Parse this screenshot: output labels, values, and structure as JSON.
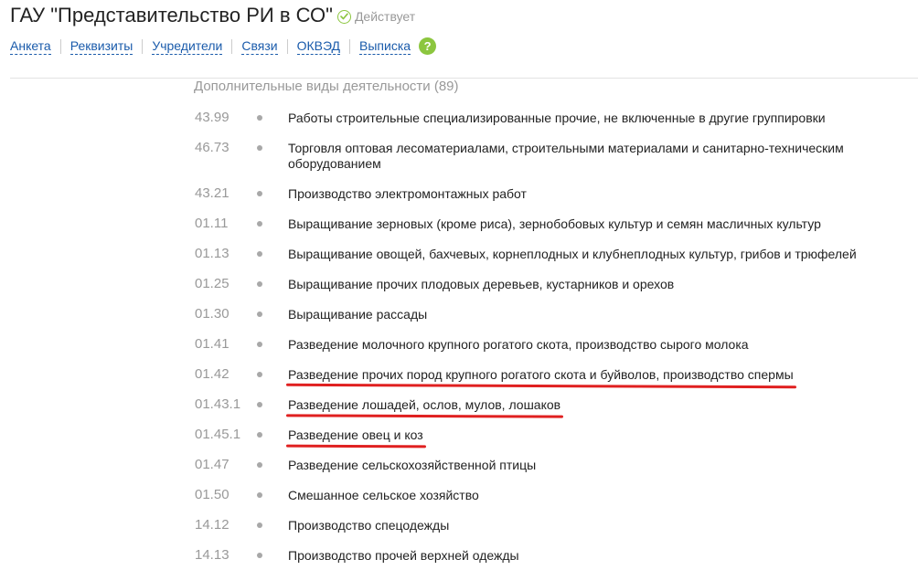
{
  "header": {
    "title": "ГАУ \"Представительство РИ в СО\"",
    "status": "Действует"
  },
  "nav": {
    "items": [
      "Анкета",
      "Реквизиты",
      "Учредители",
      "Связи",
      "ОКВЭД",
      "Выписка"
    ],
    "help_label": "?"
  },
  "section": {
    "title": "Дополнительные виды деятельности (89)"
  },
  "activities": [
    {
      "code": "43.99",
      "name": "Работы строительные специализированные прочие, не включенные в другие группировки",
      "highlighted": false
    },
    {
      "code": "46.73",
      "name": "Торговля оптовая лесоматериалами, строительными материалами и санитарно-техническим оборудованием",
      "highlighted": false
    },
    {
      "code": "43.21",
      "name": "Производство электромонтажных работ",
      "highlighted": false
    },
    {
      "code": "01.11",
      "name": "Выращивание зерновых (кроме риса), зернобобовых культур и семян масличных культур",
      "highlighted": false
    },
    {
      "code": "01.13",
      "name": "Выращивание овощей, бахчевых, корнеплодных и клубнеплодных культур, грибов и трюфелей",
      "highlighted": false
    },
    {
      "code": "01.25",
      "name": "Выращивание прочих плодовых деревьев, кустарников и орехов",
      "highlighted": false
    },
    {
      "code": "01.30",
      "name": "Выращивание рассады",
      "highlighted": false
    },
    {
      "code": "01.41",
      "name": "Разведение молочного крупного рогатого скота, производство сырого молока",
      "highlighted": false
    },
    {
      "code": "01.42",
      "name": "Разведение прочих пород крупного рогатого скота и буйволов, производство спермы",
      "highlighted": true
    },
    {
      "code": "01.43.1",
      "name": "Разведение лошадей, ослов, мулов, лошаков",
      "highlighted": true
    },
    {
      "code": "01.45.1",
      "name": "Разведение овец и коз",
      "highlighted": true
    },
    {
      "code": "01.47",
      "name": "Разведение сельскохозяйственной птицы",
      "highlighted": false
    },
    {
      "code": "01.50",
      "name": "Смешанное сельское хозяйство",
      "highlighted": false
    },
    {
      "code": "14.12",
      "name": "Производство спецодежды",
      "highlighted": false
    },
    {
      "code": "14.13",
      "name": "Производство прочей верхней одежды",
      "highlighted": false
    }
  ],
  "colors": {
    "link": "#1a5bab",
    "accent_green": "#8cc63f",
    "muted": "#999999",
    "highlight_underline": "#e02020"
  },
  "icons": {
    "status": "check-circle-icon",
    "help": "question-circle-icon",
    "bullet": "bullet-dot-icon"
  }
}
